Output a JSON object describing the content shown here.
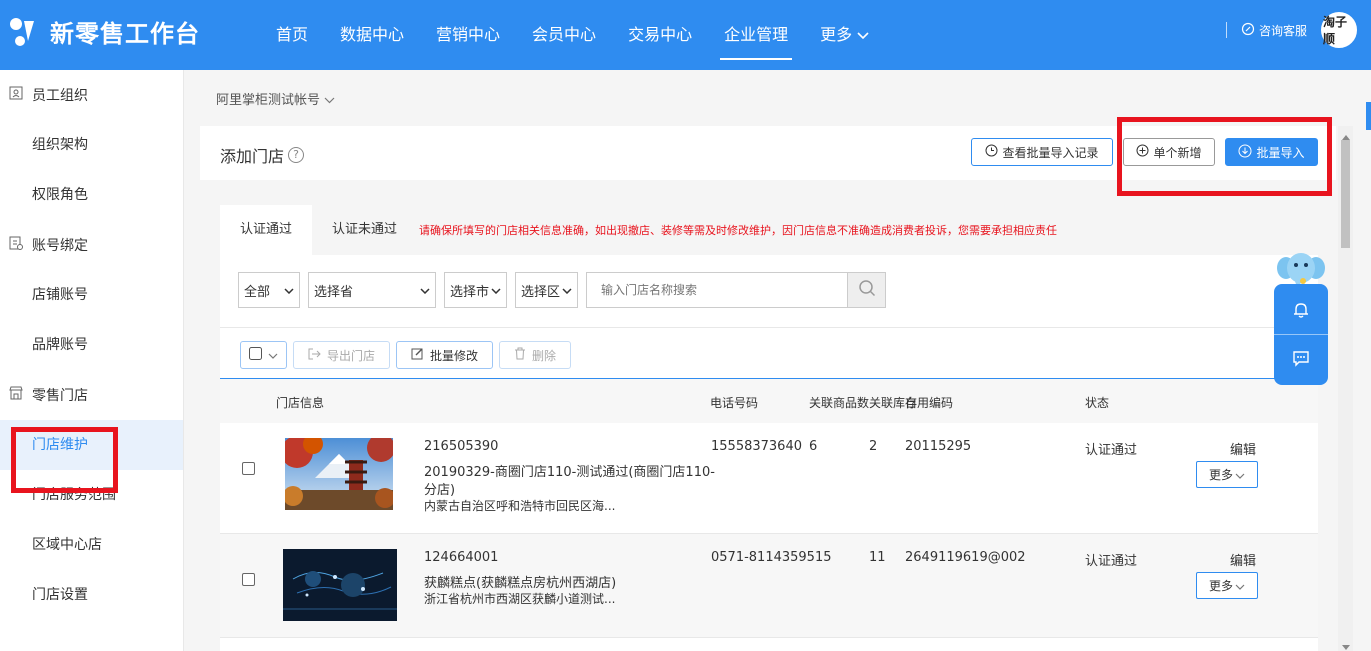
{
  "header": {
    "app_title": "新零售工作台",
    "nav": [
      "首页",
      "数据中心",
      "营销中心",
      "会员中心",
      "交易中心",
      "企业管理",
      "更多"
    ],
    "active_nav": "企业管理",
    "service_label": "咨询客服",
    "avatar_text": "淘子顺"
  },
  "sidebar": {
    "groups": [
      {
        "label": "员工组织",
        "icon": "person-card-icon",
        "items": [
          "组织架构",
          "权限角色"
        ]
      },
      {
        "label": "账号绑定",
        "icon": "account-bind-icon",
        "items": [
          "店铺账号",
          "品牌账号"
        ]
      },
      {
        "label": "零售门店",
        "icon": "store-icon",
        "items": [
          "门店维护",
          "门店服务范围",
          "区域中心店",
          "门店设置"
        ]
      }
    ],
    "active_item": "门店维护"
  },
  "breadcrumb": "阿里掌柜测试帐号",
  "page": {
    "title": "添加门店",
    "view_import_log": "查看批量导入记录",
    "single_add": "单个新增",
    "batch_import": "批量导入"
  },
  "tabs": {
    "items": [
      "认证通过",
      "认证未通过"
    ],
    "active": "认证通过",
    "notice": "请确保所填写的门店相关信息准确，如出现撤店、装修等需及时修改维护，因门店信息不准确造成消费者投诉，您需要承担相应责任"
  },
  "filters": {
    "status": "全部",
    "province": "选择省",
    "city": "选择市",
    "district": "选择区",
    "search_placeholder": "输入门店名称搜索"
  },
  "toolbar": {
    "export": "导出门店",
    "batch_edit": "批量修改",
    "delete": "删除"
  },
  "table": {
    "headers": {
      "info": "门店信息",
      "phone": "电话号码",
      "goods": "关联商品数",
      "stock": "关联库存",
      "code": "自用编码",
      "status": "状态"
    },
    "rows": [
      {
        "id": "216505390",
        "name": "20190329-商圈门店110-测试通过(商圈门店110-分店)",
        "name_line1": "20190329-商圈门店110-测试通过(商圈门店110-",
        "name_line2": "分店)",
        "address": "内蒙古自治区呼和浩特市回民区海...",
        "phone": "15558373640",
        "goods": "6",
        "stock": "2",
        "code": "20115295",
        "status": "认证通过",
        "edit": "编辑",
        "more": "更多"
      },
      {
        "id": "124664001",
        "name": "获麟糕点(获麟糕点房杭州西湖店)",
        "address": "浙江省杭州市西湖区获麟小道测试...",
        "phone": "0571-8114359515",
        "goods": "",
        "stock": "11",
        "code": "2649119619@002",
        "status": "认证通过",
        "edit": "编辑",
        "more": "更多"
      }
    ]
  },
  "colors": {
    "primary": "#2f8cf0",
    "highlight_box": "#e8141e",
    "notice_text": "#e8141e"
  }
}
